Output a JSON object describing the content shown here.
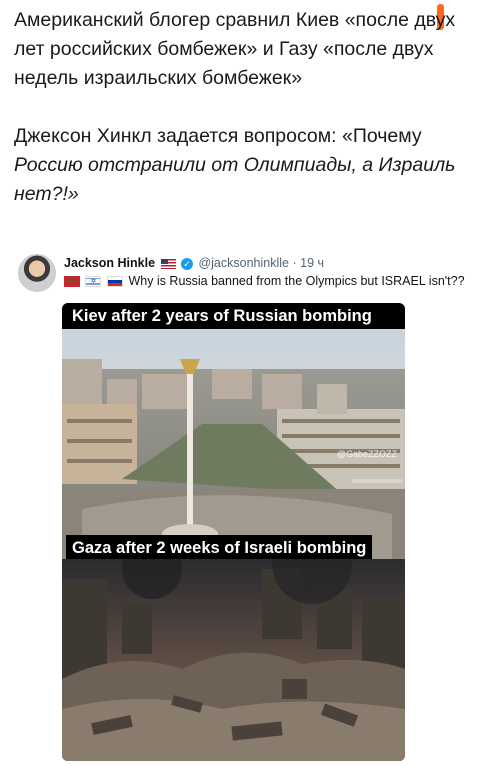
{
  "post": {
    "line1": "Американский блогер сравнил Киев «после двух",
    "line2": "лет российских бомбежек» и Газу «после двух",
    "line3": "недель израильских бомбежек»",
    "line4": "Джексон Хинкл задается вопросом: «Почему",
    "line5": "Россию отстранили от Олимпиады, а Израиль",
    "line6": "нет?!»"
  },
  "tweet": {
    "author_name": "Jackson Hinkle",
    "handle": "@jacksonhinklle",
    "separator": "·",
    "time": "19 ч",
    "text": "Why is Russia banned from the Olympics but ISRAEL isn't??",
    "flags": [
      "flag-morocco-icon",
      "flag-israel-icon",
      "flag-russia-icon"
    ]
  },
  "meme": {
    "top_caption": "Kiev after 2 years of Russian bombing",
    "bottom_caption": "Gaza after 2 weeks of Israeli bombing",
    "watermark": "@GabeZZOZZ"
  },
  "colors": {
    "accent_orange": "#ff6a1a",
    "verified_blue": "#1d9bf0",
    "handle_gray": "#536471"
  }
}
